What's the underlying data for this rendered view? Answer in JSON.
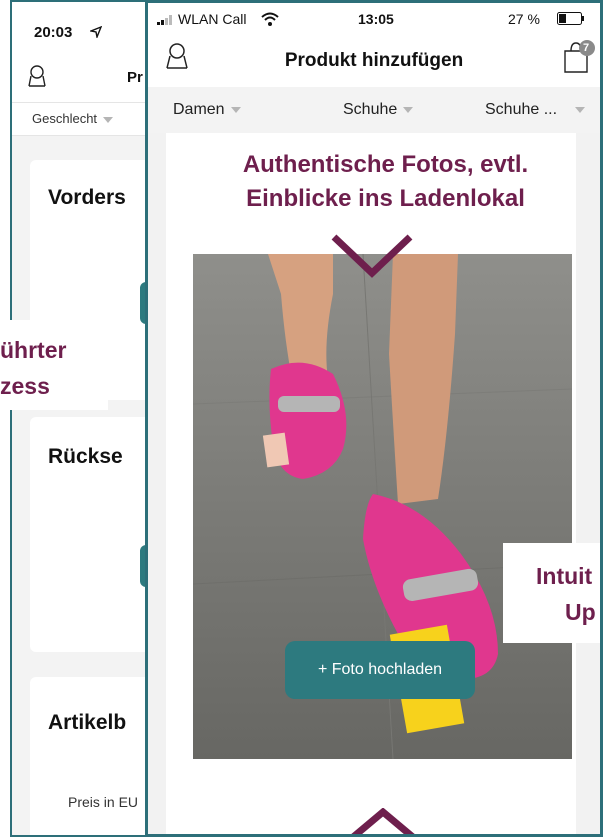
{
  "back_screen": {
    "status_time": "20:03",
    "title_partial": "Pr",
    "filter_label": "Geschlecht",
    "card1_title": "Vorders",
    "card2_title": "Rückse",
    "card3_title": "Artikelb",
    "price_label": "Preis in EU"
  },
  "front_screen": {
    "status": {
      "carrier": "WLAN Call",
      "time": "13:05",
      "battery": "27 %"
    },
    "nav": {
      "title": "Produkt hinzufügen",
      "cart_badge": "7"
    },
    "filters": [
      "Damen",
      "Schuhe",
      "Schuhe ..."
    ],
    "upload_button": "+ Foto hochladen"
  },
  "callouts": {
    "top": "Authentische Fotos, evtl.\nEinblicke ins Ladenlokal",
    "left_line1": "ührter",
    "left_line2": "zess",
    "right_line1": "Intuit",
    "right_line2": "Up"
  },
  "colors": {
    "accent_teal": "#2d7a7f",
    "callout_text": "#6e1f4d",
    "frame_border": "#2d6f79"
  }
}
